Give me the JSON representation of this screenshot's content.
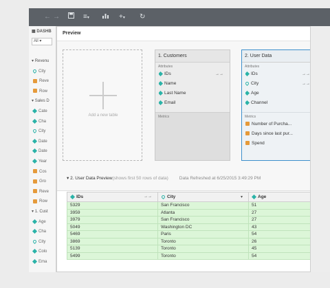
{
  "toolbar": {
    "back": "←",
    "forward": "→",
    "save_icon": "save-icon",
    "text_format": "≡",
    "chart": "chart-icon",
    "add": "+",
    "refresh": "↻"
  },
  "left_panel": {
    "title": "DASHB",
    "select_value": "All",
    "items": [
      {
        "label": "Revenu",
        "icon": "group",
        "kind": "group"
      },
      {
        "label": "City",
        "icon": "geo",
        "kind": "item"
      },
      {
        "label": "Reve",
        "icon": "metric",
        "kind": "item"
      },
      {
        "label": "Row",
        "icon": "metric",
        "kind": "item"
      },
      {
        "label": "Sales D",
        "icon": "group",
        "kind": "group"
      },
      {
        "label": "Cate",
        "icon": "attr",
        "kind": "item"
      },
      {
        "label": "Cha",
        "icon": "attr",
        "kind": "item"
      },
      {
        "label": "City",
        "icon": "geo",
        "kind": "item"
      },
      {
        "label": "Date",
        "icon": "attr",
        "kind": "item"
      },
      {
        "label": "Date",
        "icon": "attr",
        "kind": "item"
      },
      {
        "label": "Year",
        "icon": "attr",
        "kind": "item"
      },
      {
        "label": "Cos",
        "icon": "metric",
        "kind": "item"
      },
      {
        "label": "Gro",
        "icon": "metric",
        "kind": "item"
      },
      {
        "label": "Reve",
        "icon": "metric",
        "kind": "item"
      },
      {
        "label": "Row",
        "icon": "metric",
        "kind": "item"
      },
      {
        "label": "1. Cust",
        "icon": "group",
        "kind": "group"
      },
      {
        "label": "Age",
        "icon": "attr",
        "kind": "item"
      },
      {
        "label": "Cha",
        "icon": "attr",
        "kind": "item"
      },
      {
        "label": "City",
        "icon": "geo",
        "kind": "item"
      },
      {
        "label": "Colo",
        "icon": "attr",
        "kind": "item"
      },
      {
        "label": "Ema",
        "icon": "attr",
        "kind": "item"
      }
    ]
  },
  "modal": {
    "title": "Preview",
    "add_table_label": "Add a new table",
    "cards": [
      {
        "title": "1. Customers",
        "attributes_label": "Attributes",
        "attributes": [
          {
            "label": "IDs",
            "icon": "attr",
            "link": true
          },
          {
            "label": "Name",
            "icon": "attr",
            "link": false
          },
          {
            "label": "Last Name",
            "icon": "attr",
            "link": false
          },
          {
            "label": "Email",
            "icon": "attr",
            "link": false
          }
        ],
        "metrics_label": "Metrics",
        "metrics": []
      },
      {
        "title": "2. User Data",
        "attributes_label": "Attributes",
        "attributes": [
          {
            "label": "IDs",
            "icon": "attr",
            "link": true
          },
          {
            "label": "City",
            "icon": "geo",
            "link": true
          },
          {
            "label": "Age",
            "icon": "attr",
            "link": false
          },
          {
            "label": "Channel",
            "icon": "attr",
            "link": false
          }
        ],
        "metrics_label": "Metrics",
        "metrics": [
          {
            "label": "Number of Purcha...",
            "icon": "metric"
          },
          {
            "label": "Days since last pur...",
            "icon": "metric"
          },
          {
            "label": "Spend",
            "icon": "metric"
          }
        ]
      }
    ],
    "preview_title": "2. User Data  Preview",
    "preview_note": "(shows first 50 rows of data)",
    "refreshed": "Data Refreshed at 6/25/2015 3:49:29 PM",
    "table": {
      "columns": [
        {
          "label": "IDs",
          "icon": "attr",
          "control": "link"
        },
        {
          "label": "City",
          "icon": "geo",
          "control": "caret"
        },
        {
          "label": "Age",
          "icon": "attr",
          "control": "none"
        }
      ],
      "rows": [
        [
          "5329",
          "San Francisco",
          "51"
        ],
        [
          "3959",
          "Atlanta",
          "27"
        ],
        [
          "3979",
          "San Francisco",
          "27"
        ],
        [
          "5049",
          "Washington DC",
          "43"
        ],
        [
          "5469",
          "Paris",
          "54"
        ],
        [
          "3869",
          "Toronto",
          "26"
        ],
        [
          "5139",
          "Toronto",
          "45"
        ],
        [
          "5499",
          "Toronto",
          "54"
        ]
      ]
    }
  },
  "colors": {
    "toolbar": "#5c6167",
    "attribute_icon": "#2bb3a8",
    "metric_icon": "#e59a3a",
    "selected_border": "#3c8fcc",
    "row_fill": "#dcf6d8"
  }
}
